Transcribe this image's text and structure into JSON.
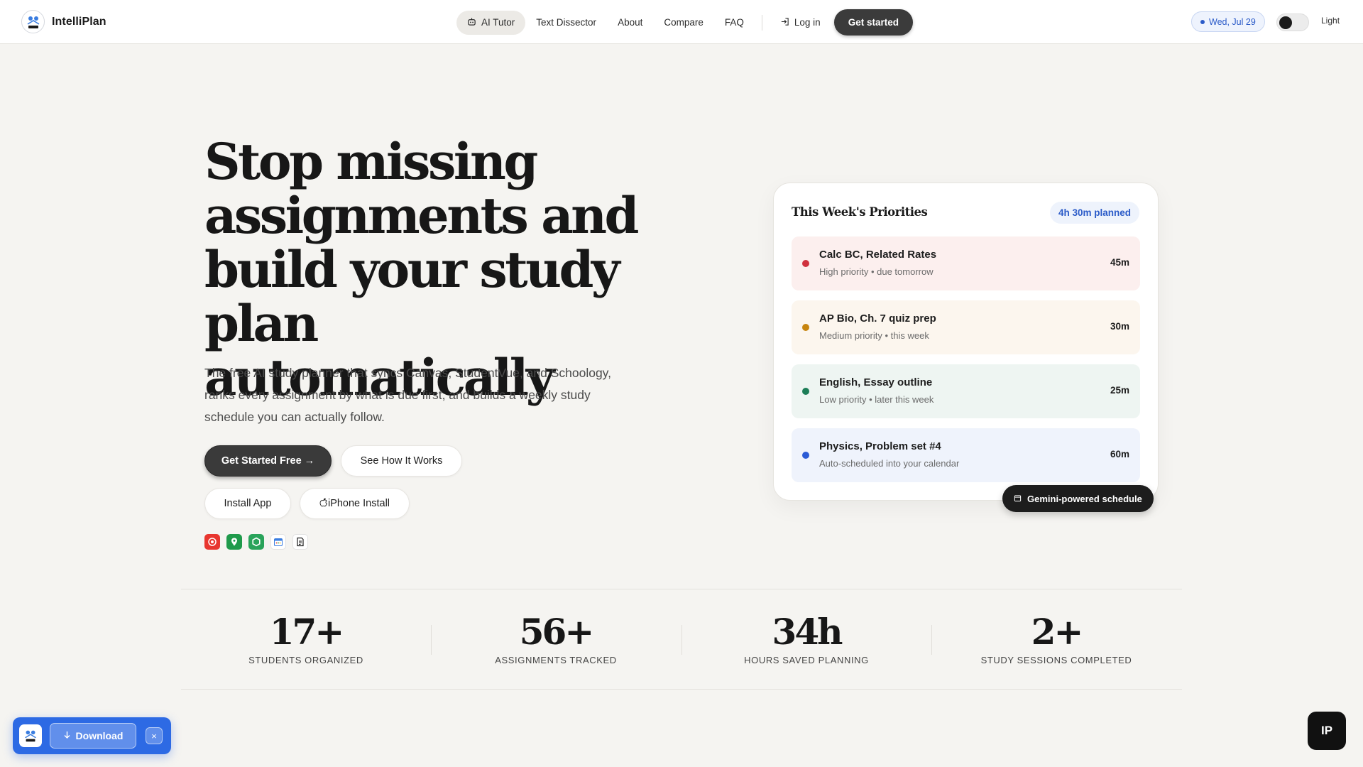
{
  "nav": {
    "brand": "IntelliPlan",
    "links": [
      {
        "label": "AI Tutor",
        "icon": "robot-icon"
      },
      {
        "label": "Text Dissector"
      },
      {
        "label": "About"
      },
      {
        "label": "Compare"
      },
      {
        "label": "FAQ"
      }
    ],
    "login": "Log in",
    "cta": "Get started",
    "date": "Wed, Jul 29",
    "theme_label": "Light"
  },
  "hero": {
    "title": "Stop missing assignments and build your study plan automatically",
    "subtitle": "The free AI study planner that syncs Canvas, StudentVue, and Schoology, ranks every assignment by what is due first, and builds a weekly study schedule you can actually follow.",
    "buttons": {
      "primary": "Get Started Free →",
      "secondary": "See How It Works",
      "install": "Install App",
      "iphone": "iPhone Install"
    },
    "integrations": [
      "target-icon",
      "location-pin-icon",
      "hexagon-icon",
      "calendar-icon",
      "document-icon"
    ]
  },
  "priorities": {
    "title": "This Week's Priorities",
    "planned": "4h 30m planned",
    "tasks": [
      {
        "name": "Calc BC, Related Rates",
        "meta": "High priority • due tomorrow",
        "duration": "45m",
        "color": "#d0313d",
        "bg": "#fcefee"
      },
      {
        "name": "AP Bio, Ch. 7 quiz prep",
        "meta": "Medium priority • this week",
        "duration": "30m",
        "color": "#c7850f",
        "bg": "#fcf6ee"
      },
      {
        "name": "English, Essay outline",
        "meta": "Low priority • later this week",
        "duration": "25m",
        "color": "#1c7d57",
        "bg": "#eef5f2"
      },
      {
        "name": "Physics, Problem set #4",
        "meta": "Auto-scheduled into your calendar",
        "duration": "60m",
        "color": "#2b5bd6",
        "bg": "#eff3fc"
      }
    ],
    "badge": "Gemini-powered schedule"
  },
  "stats": [
    {
      "value": "17+",
      "label": "STUDENTS ORGANIZED"
    },
    {
      "value": "56+",
      "label": "ASSIGNMENTS TRACKED"
    },
    {
      "value": "34h",
      "label": "HOURS SAVED PLANNING"
    },
    {
      "value": "2+",
      "label": "STUDY SESSIONS COMPLETED"
    }
  ],
  "download_bar": {
    "label": "Download",
    "close": "×"
  },
  "corner_badge": "IP",
  "colors": {
    "accent_blue": "#2b5bc8",
    "dark_button": "#3a3a3a",
    "background": "#f5f4f1"
  }
}
